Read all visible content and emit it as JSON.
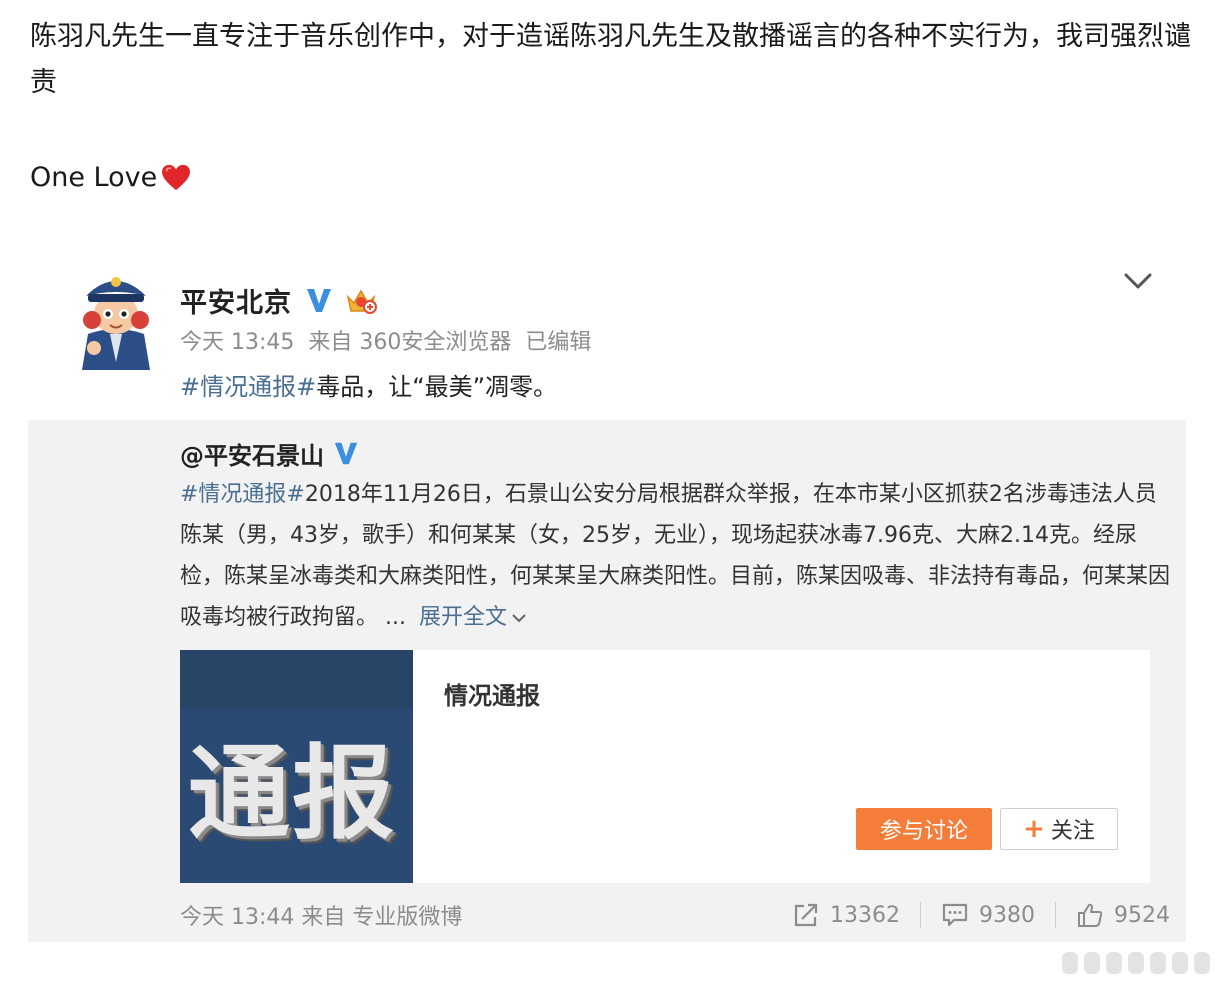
{
  "statement": {
    "text": "陈羽凡先生一直专注于音乐创作中，对于造谣陈羽凡先生及散播谣言的各种不实行为，我司强烈谴责",
    "sign_off": "One Love"
  },
  "post": {
    "author": "平安北京",
    "time": "今天 13:45",
    "source": "来自 360安全浏览器",
    "edited": "已编辑",
    "hashtag": "#情况通报#",
    "text": "毒品，让“最美”凋零。"
  },
  "repost": {
    "author": "@平安石景山",
    "hashtag": "#情况通报#",
    "text": "2018年11月26日，石景山公安分局根据群众举报，在本市某小区抓获2名涉毒违法人员陈某（男，43岁，歌手）和何某某（女，25岁，无业），现场起获冰毒7.96克、大麻2.14克。经尿检，陈某呈冰毒类和大麻类阳性，何某某呈大麻类阳性。目前，陈某因吸毒、非法持有毒品，何某某因吸毒均被行政拘留。",
    "ellipsis": "...",
    "expand_label": "展开全文",
    "topic": {
      "thumb_text": "通报",
      "title": "情况通报",
      "discuss_label": "参与讨论",
      "follow_plus": "+",
      "follow_label": "关注"
    },
    "footer": {
      "time_source": "今天 13:44 来自 专业版微博",
      "reposts": "13362",
      "comments": "9380",
      "likes": "9524"
    }
  },
  "colors": {
    "hashtag": "#4a6f93",
    "discuss_button": "#f47d3a",
    "repost_bg": "#f2f2f2",
    "thumb_bg": "#2b4a73",
    "heart": "#e0262b",
    "v_badge": "#3a8fe0"
  }
}
